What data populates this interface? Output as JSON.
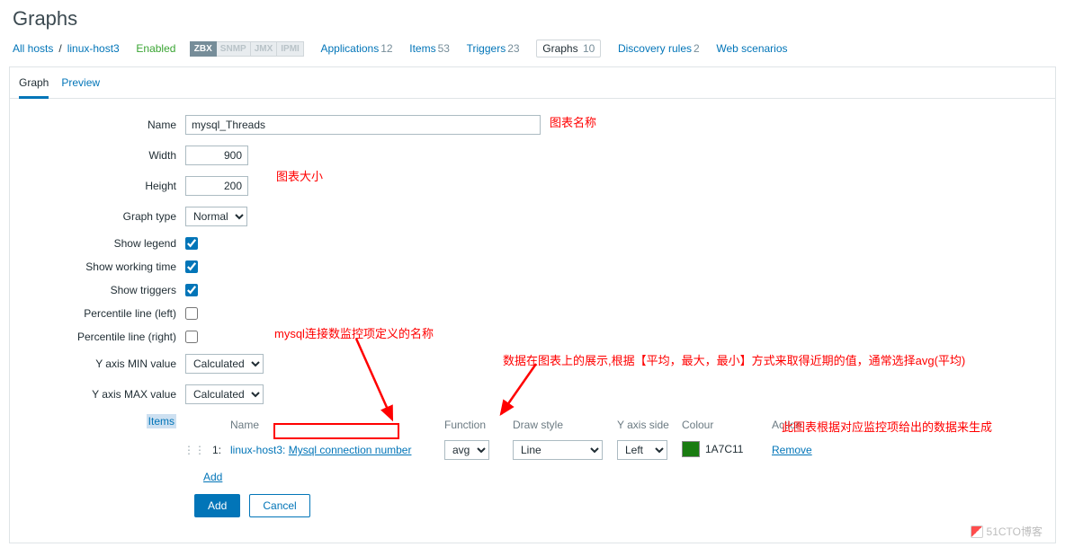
{
  "page_title": "Graphs",
  "breadcrumb": {
    "all_hosts": "All hosts",
    "host": "linux-host3",
    "enabled": "Enabled",
    "badges": [
      "ZBX",
      "SNMP",
      "JMX",
      "IPMI"
    ],
    "links": [
      {
        "label": "Applications",
        "count": "12"
      },
      {
        "label": "Items",
        "count": "53"
      },
      {
        "label": "Triggers",
        "count": "23"
      },
      {
        "label": "Graphs",
        "count": "10",
        "active": true
      },
      {
        "label": "Discovery rules",
        "count": "2"
      },
      {
        "label": "Web scenarios",
        "count": ""
      }
    ]
  },
  "tabs": {
    "graph": "Graph",
    "preview": "Preview"
  },
  "form": {
    "name_label": "Name",
    "name_value": "mysql_Threads",
    "width_label": "Width",
    "width_value": "900",
    "height_label": "Height",
    "height_value": "200",
    "graph_type_label": "Graph type",
    "graph_type_value": "Normal",
    "show_legend_label": "Show legend",
    "show_legend": true,
    "show_working_label": "Show working time",
    "show_working": true,
    "show_triggers_label": "Show triggers",
    "show_triggers": true,
    "perc_left_label": "Percentile line (left)",
    "perc_left": false,
    "perc_right_label": "Percentile line (right)",
    "perc_right": false,
    "ymin_label": "Y axis MIN value",
    "ymin_value": "Calculated",
    "ymax_label": "Y axis MAX value",
    "ymax_value": "Calculated",
    "items_label": "Items"
  },
  "items_table": {
    "headers": {
      "name": "Name",
      "function": "Function",
      "draw": "Draw style",
      "side": "Y axis side",
      "colour": "Colour",
      "action": "Action"
    },
    "row": {
      "index": "1:",
      "host": "linux-host3:",
      "item_name": "Mysql connection number",
      "function": "avg",
      "draw": "Line",
      "side": "Left",
      "colour": "1A7C11",
      "colour_hex": "#1A7C11",
      "remove": "Remove"
    },
    "add": "Add"
  },
  "buttons": {
    "add": "Add",
    "cancel": "Cancel"
  },
  "annotations": {
    "name": "图表名称",
    "size": "图表大小",
    "item_def": "mysql连接数监控项定义的名称",
    "function": "数据在图表上的展示,根据【平均，最大，最小】方式来取得近期的值，通常选择avg(平均)",
    "chart_gen": "此图表根据对应监控项给出的数据来生成"
  },
  "watermark": "51CTO博客"
}
